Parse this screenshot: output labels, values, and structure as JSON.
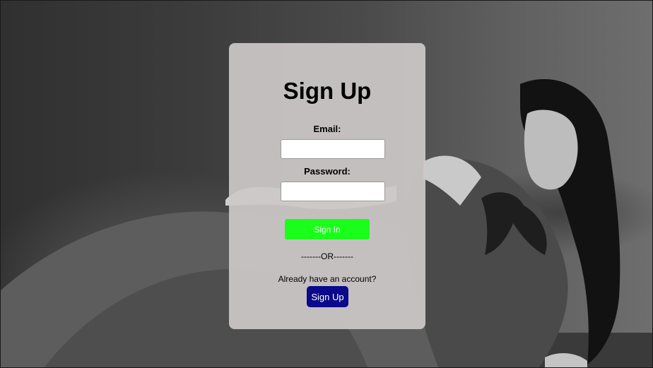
{
  "form": {
    "title": "Sign Up",
    "email_label": "Email:",
    "email_value": "",
    "password_label": "Password:",
    "password_value": "",
    "sign_in_button": "Sign In",
    "divider": "-------OR-------",
    "already_text": "Already have an account?",
    "sign_up_button": "Sign Up"
  },
  "colors": {
    "card": "#cdc8c8",
    "sign_in_button": "#19ff19",
    "sign_up_button": "#0a0a8a",
    "background": "#3c3c3c"
  }
}
